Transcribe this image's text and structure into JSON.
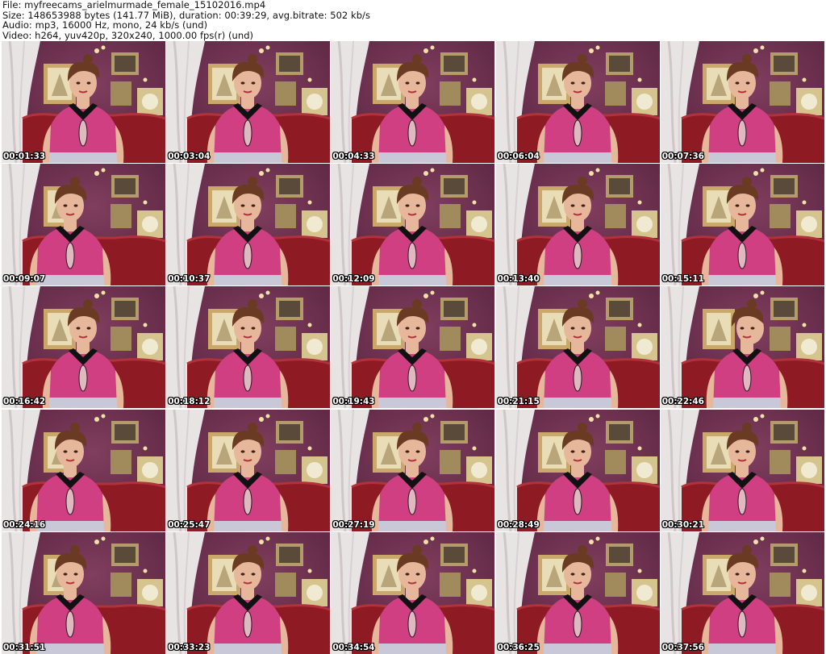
{
  "header": {
    "file": "File: myfreecams_arielmurmade_female_15102016.mp4",
    "size": "Size: 148653988 bytes (141.77 MiB), duration: 00:39:29, avg.bitrate: 502 kb/s",
    "audio": "Audio: mp3, 16000 Hz, mono, 24 kb/s (und)",
    "video": "Video: h264, yuv420p, 320x240, 1000.00 fps(r) (und)"
  },
  "colors": {
    "wall": "#6e2f4f",
    "curtain": "#e9e4e4",
    "sofa": "#8e1b23",
    "top": "#cf3f82",
    "collar": "#111111",
    "skin": "#e7b79c",
    "hair": "#6a3a22",
    "frame": "#c9a86a"
  },
  "thumbnails": [
    {
      "time": "00:01:33",
      "pose": "center"
    },
    {
      "time": "00:03:04",
      "pose": "center"
    },
    {
      "time": "00:04:33",
      "pose": "center"
    },
    {
      "time": "00:06:04",
      "pose": "center"
    },
    {
      "time": "00:07:36",
      "pose": "center"
    },
    {
      "time": "00:09:07",
      "pose": "left"
    },
    {
      "time": "00:10:37",
      "pose": "center"
    },
    {
      "time": "00:12:09",
      "pose": "center"
    },
    {
      "time": "00:13:40",
      "pose": "center"
    },
    {
      "time": "00:15:11",
      "pose": "center"
    },
    {
      "time": "00:16:42",
      "pose": "center"
    },
    {
      "time": "00:18:12",
      "pose": "center"
    },
    {
      "time": "00:19:43",
      "pose": "center"
    },
    {
      "time": "00:21:15",
      "pose": "center"
    },
    {
      "time": "00:22:46",
      "pose": "turned"
    },
    {
      "time": "00:24:16",
      "pose": "left"
    },
    {
      "time": "00:25:47",
      "pose": "center"
    },
    {
      "time": "00:27:19",
      "pose": "center"
    },
    {
      "time": "00:28:49",
      "pose": "center"
    },
    {
      "time": "00:30:21",
      "pose": "center"
    },
    {
      "time": "00:31:51",
      "pose": "left"
    },
    {
      "time": "00:33:23",
      "pose": "center"
    },
    {
      "time": "00:34:54",
      "pose": "center"
    },
    {
      "time": "00:36:25",
      "pose": "center"
    },
    {
      "time": "00:37:56",
      "pose": "center"
    }
  ]
}
